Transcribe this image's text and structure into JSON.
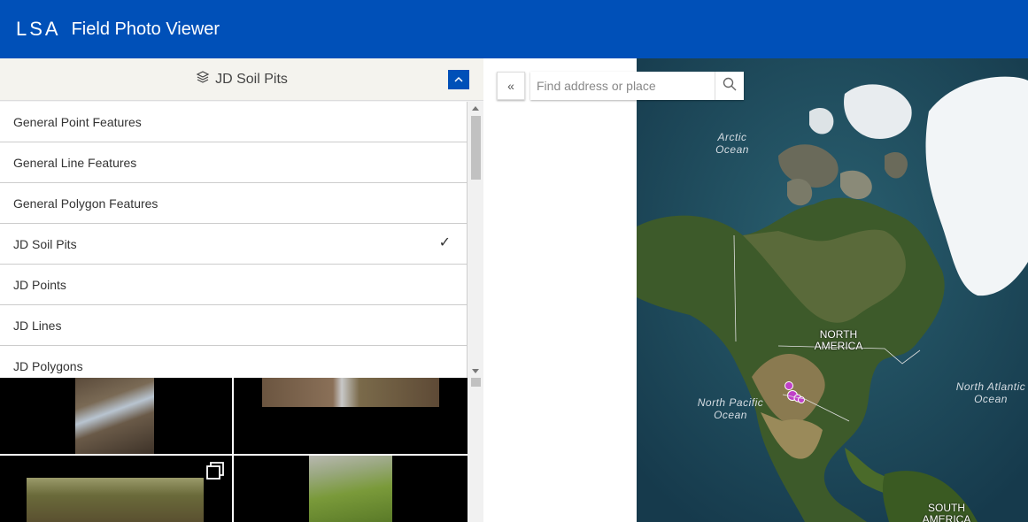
{
  "header": {
    "logo_text": "LSA",
    "app_title": "Field Photo Viewer",
    "bg_color": "#0050b8"
  },
  "layer_selector": {
    "selected_label": "JD Soil Pits",
    "icon": "layers-icon",
    "collapse_icon": "chevron-up-icon"
  },
  "layer_list": {
    "items": [
      {
        "label": "General Point Features",
        "selected": false
      },
      {
        "label": "General Line Features",
        "selected": false
      },
      {
        "label": "General Polygon Features",
        "selected": false
      },
      {
        "label": "JD Soil Pits",
        "selected": true,
        "check": "✓"
      },
      {
        "label": "JD Points",
        "selected": false
      },
      {
        "label": "JD Lines",
        "selected": false
      },
      {
        "label": "JD Polygons",
        "selected": false
      }
    ]
  },
  "map": {
    "collapse_label": "«",
    "search": {
      "placeholder": "Find address or place",
      "value": ""
    },
    "labels": {
      "arctic_ocean": "Arctic Ocean",
      "north_america": "NORTH AMERICA",
      "north_pacific_ocean": "North Pacific Ocean",
      "north_atlantic_ocean": "North Atlantic Ocean",
      "south_america": "SOUTH AMERICA"
    },
    "marker_color": "#c040c8"
  }
}
